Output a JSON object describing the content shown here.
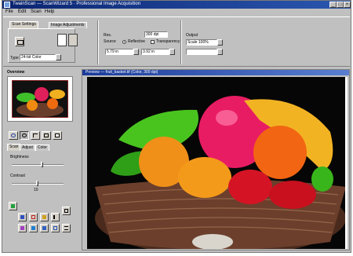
{
  "window": {
    "title": "TwainScan — ScanWizard 5 · Professional Image Acquisition",
    "controls": [
      "_",
      "□",
      "×"
    ]
  },
  "menubar": {
    "items": [
      "File",
      "Edit",
      "Scan",
      "Help"
    ]
  },
  "tabs": [
    "Scan Settings",
    "Image Adjustments"
  ],
  "scan_settings": {
    "type_label": "Type",
    "type_value": "24-bit Color",
    "res_label": "Res.",
    "res_value": "300 dpi",
    "source_label": "Source",
    "source_options": [
      "Reflective",
      "Transparency"
    ],
    "width_value": "5.79 in",
    "height_value": "3.92 in",
    "output_label": "Output",
    "output_value": "Scale 100%"
  },
  "left_panel": {
    "overview_label": "Overview",
    "settings_tabs": [
      "Scan",
      "Adjust",
      "Color"
    ],
    "brightness_label": "Brightness",
    "brightness_value": 0.6,
    "contrast_label": "Contrast",
    "contrast_value": 0.5,
    "contrast_number": "10",
    "tool_icons": [
      "rotate-icon",
      "zoom-icon",
      "crop-icon",
      "fit-icon",
      "full-icon"
    ],
    "grid_icons": [
      "auto-icon",
      "levels-icon",
      "curves-icon",
      "balance-icon",
      "pointer-icon",
      "gamma-icon",
      "hue-icon",
      "sharpen-icon",
      "descreen-icon",
      "settings-icon"
    ]
  },
  "viewer": {
    "title": "Preview — fruit_basket.tif  (Color, 300 dpi)"
  },
  "colors": {
    "title_dark": "#0a2470",
    "title_light": "#2b57b0",
    "panel": "#c0c0c0",
    "highlight": "#ffffff",
    "shadow": "#808080"
  }
}
